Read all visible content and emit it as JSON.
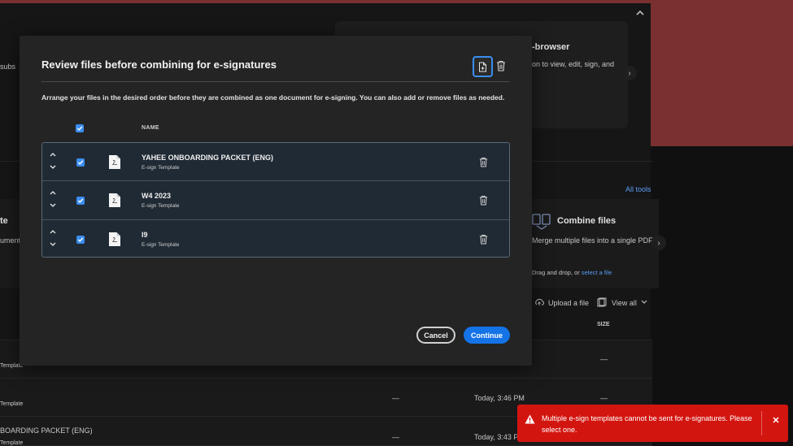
{
  "background": {
    "subs_fragment": "subs",
    "browser_card_title": "-browser",
    "browser_card_desc": "on to view, edit, sign, and",
    "all_tools": "All tools",
    "te_fragment": "te",
    "ument_fragment": "ument",
    "combine_title": "Combine files",
    "combine_desc": "Merge multiple files into a single PDF",
    "drop_text": "Drag and drop, or",
    "drop_link": "select a file",
    "upload_label": "Upload a file",
    "view_all_label": "View all",
    "size_header": "SIZE",
    "rows": [
      {
        "label": "Template",
        "sub": "",
        "dash1": "",
        "time": "",
        "dash2": "—"
      },
      {
        "label": "Template",
        "sub": "",
        "dash1": "—",
        "time": "Today, 3:46 PM",
        "dash2": "—"
      },
      {
        "label": "BOARDING PACKET (ENG)",
        "sub": "Template",
        "dash1": "—",
        "time": "Today, 3:43 PM",
        "dash2": "—"
      }
    ]
  },
  "modal": {
    "title": "Review files before combining for e-signatures",
    "description": "Arrange your files in the desired order before they are combined as one document for e-signing. You can also add or remove files as needed.",
    "column_name": "NAME",
    "files": [
      {
        "name": "YAHEE ONBOARDING PACKET (ENG)",
        "type": "E-sign Template"
      },
      {
        "name": "W4 2023",
        "type": "E-sign Template"
      },
      {
        "name": "I9",
        "type": "E-sign Template"
      }
    ],
    "cancel_label": "Cancel",
    "continue_label": "Continue"
  },
  "toast": {
    "message": "Multiple e-sign templates cannot be sent for e-signatures. Please select one.",
    "close_label": "✕"
  },
  "colors": {
    "accent": "#1473e6",
    "toast": "#d31510",
    "modal_bg": "#242424"
  }
}
